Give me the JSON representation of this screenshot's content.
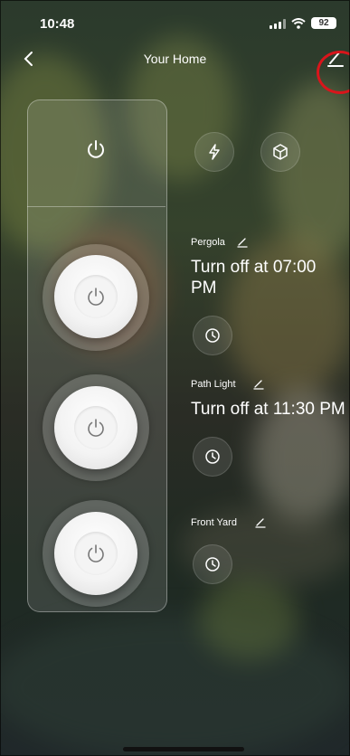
{
  "status_bar": {
    "time": "10:48",
    "battery": "92"
  },
  "header": {
    "title": "Your Home"
  },
  "zones": [
    {
      "name": "Pergola",
      "schedule": "Turn off at 07:00 PM"
    },
    {
      "name": "Path Light",
      "schedule": "Turn off at 11:30 PM"
    },
    {
      "name": "Front Yard",
      "schedule": ""
    }
  ],
  "icons": {
    "back": "chevron-left-icon",
    "edit": "pencil-icon",
    "all_power": "power-icon",
    "scenes": "lightning-icon",
    "device": "cube-icon",
    "timer": "clock-icon"
  },
  "colors": {
    "highlight_ring": "#d9151b"
  }
}
